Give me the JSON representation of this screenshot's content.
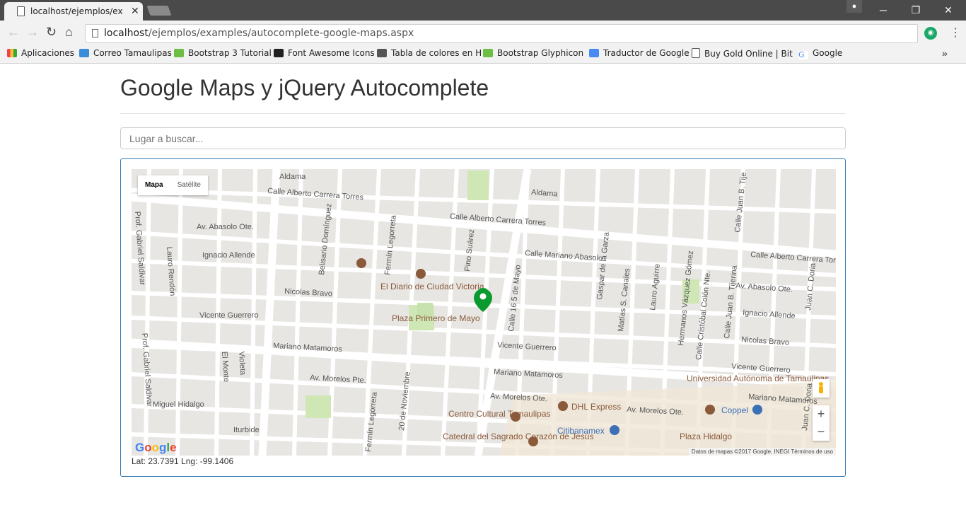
{
  "browser": {
    "tab_title": "localhost/ejemplos/exam",
    "url_host": "localhost",
    "url_path": "/ejemplos/examples/autocomplete-google-maps.aspx",
    "bookmarks": [
      {
        "label": "Aplicaciones",
        "color": "#e44"
      },
      {
        "label": "Correo Tamaulipas",
        "color": "#3a8dd8"
      },
      {
        "label": "Bootstrap 3 Tutorial",
        "color": "#6cbe45"
      },
      {
        "label": "Font Awesome Icons",
        "color": "#222"
      },
      {
        "label": "Tabla de colores en H",
        "color": "#444"
      },
      {
        "label": "Bootstrap Glyphicon",
        "color": "#6cbe45"
      },
      {
        "label": "Traductor de Google",
        "color": "#4a8af4"
      },
      {
        "label": "Buy Gold Online | Bit",
        "color": "#e9a82b"
      },
      {
        "label": "Google",
        "color": "#4a8af4"
      }
    ]
  },
  "page": {
    "title": "Google Maps y jQuery Autocomplete",
    "search_placeholder": "Lugar a buscar...",
    "map_type": {
      "map": "Mapa",
      "satellite": "Satélite"
    },
    "attribution": "Datos de mapas ©2017 Google, INEGI   Términos de uso",
    "google_logo": "Google",
    "coords": "Lat: 23.7391 Lng: -99.1406",
    "colors": {
      "panel_border": "#337ab7",
      "marker": "#0a9a2e"
    }
  },
  "map_labels": {
    "streets": [
      "Aldama",
      "Calle Alberto Carrera Torres",
      "Av. Abasolo Ote.",
      "Ignacio Allende",
      "Nicolas Bravo",
      "Vicente Guerrero",
      "Mariano Matamoros",
      "Av. Morelos Pte.",
      "Miguel Hidalgo",
      "Iturbide",
      "Calle Mariano Abasolo",
      "Calle 16 5 de Mayo",
      "Gaspar de la Garza",
      "Matías S. Canales",
      "Lauro Aguirre",
      "Hermanos Vázquez Gómez",
      "Calle Cristóbal Colón Nte.",
      "Calle Juan B. Tijerina",
      "Av. Morelos Ote.",
      "Pino Suárez",
      "Fermín Legorreta",
      "Belisario Domínguez",
      "Lauro Rendón",
      "Prof. Gabriel Saldivar",
      "El Monte",
      "Violeta",
      "Juan C. Doria",
      "20 de Noviembre",
      "Calle Juan B. Tije"
    ],
    "pois": [
      "El Diario de Ciudad Victoria",
      "Plaza Primero de Mayo",
      "Centro Cultural Tamaulipas",
      "Catedral del Sagrado Corazón de Jesús",
      "DHL Express",
      "Citibanamex",
      "Universidad Autónoma de Tamaulipas",
      "Coppel",
      "Plaza Hidalgo"
    ]
  }
}
